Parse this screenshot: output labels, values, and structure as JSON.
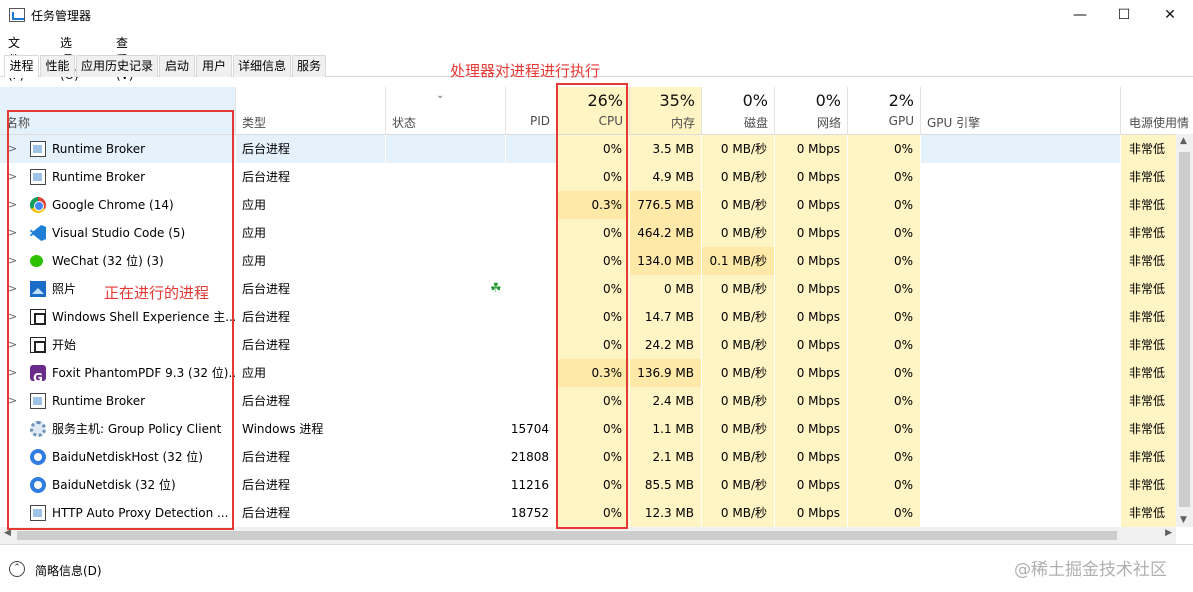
{
  "window": {
    "title": "任务管理器",
    "controls": {
      "minimize": "—",
      "maximize": "☐",
      "close": "✕"
    }
  },
  "menu": [
    "文件(F)",
    "选项(O)",
    "查看(V)"
  ],
  "tabs": [
    "进程",
    "性能",
    "应用历史记录",
    "启动",
    "用户",
    "详细信息",
    "服务"
  ],
  "active_tab": "进程",
  "columns": {
    "name": "名称",
    "type": "类型",
    "status": "状态",
    "pid": "PID",
    "cpu": {
      "pct": "26%",
      "label": "CPU"
    },
    "memory": {
      "pct": "35%",
      "label": "内存"
    },
    "disk": {
      "pct": "0%",
      "label": "磁盘"
    },
    "network": {
      "pct": "0%",
      "label": "网络"
    },
    "gpu": {
      "pct": "2%",
      "label": "GPU"
    },
    "gpu_engine": "GPU 引擎",
    "power": "电源使用情"
  },
  "sort_indicator": "⌄",
  "processes": [
    {
      "name": "Runtime Broker",
      "icon": "window-icon",
      "type": "后台进程",
      "pid": "",
      "cpu": "0%",
      "memory": "3.5 MB",
      "disk": "0 MB/秒",
      "network": "0 Mbps",
      "gpu": "0%",
      "power": "非常低"
    },
    {
      "name": "Runtime Broker",
      "icon": "window-icon",
      "type": "后台进程",
      "pid": "",
      "cpu": "0%",
      "memory": "4.9 MB",
      "disk": "0 MB/秒",
      "network": "0 Mbps",
      "gpu": "0%",
      "power": "非常低"
    },
    {
      "name": "Google Chrome (14)",
      "icon": "chrome-icon",
      "type": "应用",
      "pid": "",
      "cpu": "0.3%",
      "memory": "776.5 MB",
      "disk": "0 MB/秒",
      "network": "0 Mbps",
      "gpu": "0%",
      "power": "非常低"
    },
    {
      "name": "Visual Studio Code (5)",
      "icon": "vscode-icon",
      "type": "应用",
      "pid": "",
      "cpu": "0%",
      "memory": "464.2 MB",
      "disk": "0 MB/秒",
      "network": "0 Mbps",
      "gpu": "0%",
      "power": "非常低"
    },
    {
      "name": "WeChat (32 位) (3)",
      "icon": "wechat-icon",
      "type": "应用",
      "pid": "",
      "cpu": "0%",
      "memory": "134.0 MB",
      "disk": "0.1 MB/秒",
      "network": "0 Mbps",
      "gpu": "0%",
      "power": "非常低"
    },
    {
      "name": "照片",
      "icon": "photos-icon",
      "type": "后台进程",
      "pid": "",
      "cpu": "0%",
      "memory": "0 MB",
      "disk": "0 MB/秒",
      "network": "0 Mbps",
      "gpu": "0%",
      "power": "非常低"
    },
    {
      "name": "Windows Shell Experience 主...",
      "icon": "shell-icon",
      "type": "后台进程",
      "pid": "",
      "cpu": "0%",
      "memory": "14.7 MB",
      "disk": "0 MB/秒",
      "network": "0 Mbps",
      "gpu": "0%",
      "power": "非常低"
    },
    {
      "name": "开始",
      "icon": "shell-icon",
      "type": "后台进程",
      "pid": "",
      "cpu": "0%",
      "memory": "24.2 MB",
      "disk": "0 MB/秒",
      "network": "0 Mbps",
      "gpu": "0%",
      "power": "非常低"
    },
    {
      "name": "Foxit PhantomPDF 9.3 (32 位)...",
      "icon": "foxit-icon",
      "type": "应用",
      "pid": "",
      "cpu": "0.3%",
      "memory": "136.9 MB",
      "disk": "0 MB/秒",
      "network": "0 Mbps",
      "gpu": "0%",
      "power": "非常低"
    },
    {
      "name": "Runtime Broker",
      "icon": "window-icon",
      "type": "后台进程",
      "pid": "",
      "cpu": "0%",
      "memory": "2.4 MB",
      "disk": "0 MB/秒",
      "network": "0 Mbps",
      "gpu": "0%",
      "power": "非常低"
    },
    {
      "name": "服务主机: Group Policy Client",
      "icon": "gear-icon",
      "type": "Windows 进程",
      "pid": "15704",
      "cpu": "0%",
      "memory": "1.1 MB",
      "disk": "0 MB/秒",
      "network": "0 Mbps",
      "gpu": "0%",
      "power": "非常低"
    },
    {
      "name": "BaiduNetdiskHost (32 位)",
      "icon": "baidu-icon",
      "type": "后台进程",
      "pid": "21808",
      "cpu": "0%",
      "memory": "2.1 MB",
      "disk": "0 MB/秒",
      "network": "0 Mbps",
      "gpu": "0%",
      "power": "非常低"
    },
    {
      "name": "BaiduNetdisk (32 位)",
      "icon": "baidu-icon",
      "type": "后台进程",
      "pid": "11216",
      "cpu": "0%",
      "memory": "85.5 MB",
      "disk": "0 MB/秒",
      "network": "0 Mbps",
      "gpu": "0%",
      "power": "非常低"
    },
    {
      "name": "HTTP Auto Proxy Detection ...",
      "icon": "window-icon",
      "type": "后台进程",
      "pid": "18752",
      "cpu": "0%",
      "memory": "12.3 MB",
      "disk": "0 MB/秒",
      "network": "0 Mbps",
      "gpu": "0%",
      "power": "非常低"
    }
  ],
  "footer": {
    "fewer_details": "简略信息(D)"
  },
  "annotations": {
    "cpu_note": "处理器对进程进行执行",
    "process_note": "正在进行的进程"
  },
  "watermark": "@稀土掘金技术社区",
  "colors": {
    "annotation": "#e53935",
    "heat_light": "#fff4c4",
    "heat_strong": "#ffe9a8",
    "selected_row": "#e5f1fb"
  }
}
